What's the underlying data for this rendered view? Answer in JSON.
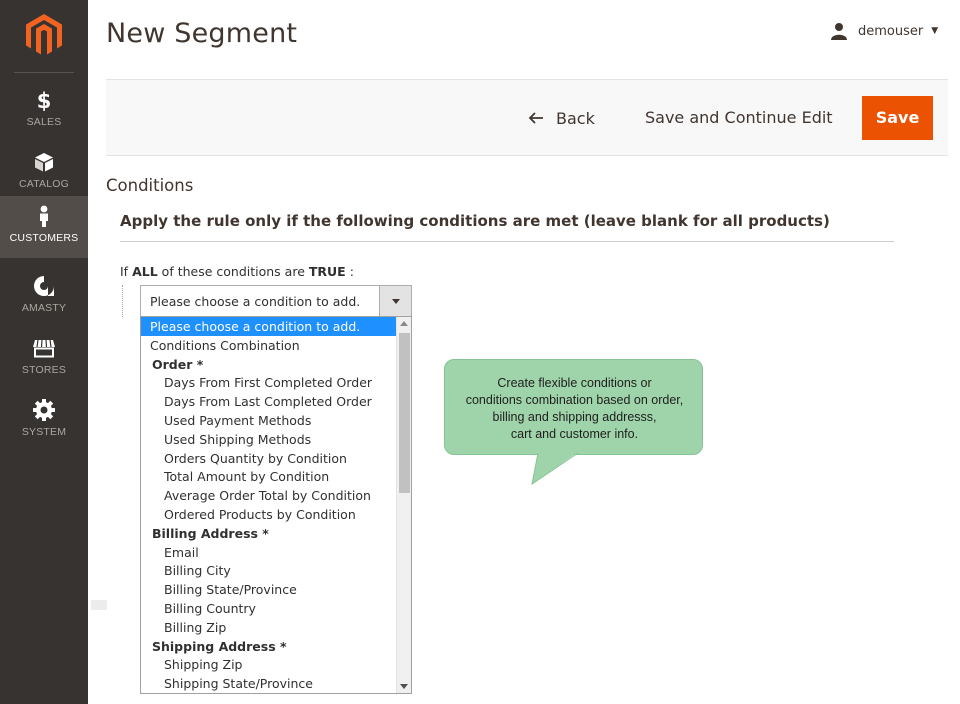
{
  "sidebar": {
    "items": [
      {
        "label": "SALES",
        "icon": "dollar-icon"
      },
      {
        "label": "CATALOG",
        "icon": "box-icon"
      },
      {
        "label": "CUSTOMERS",
        "icon": "person-icon",
        "active": true
      },
      {
        "label": "AMASTY",
        "icon": "amasty-icon"
      },
      {
        "label": "STORES",
        "icon": "store-icon"
      },
      {
        "label": "SYSTEM",
        "icon": "gear-icon"
      }
    ]
  },
  "header": {
    "title": "New Segment",
    "user": "demouser"
  },
  "actions": {
    "back": "Back",
    "save_continue": "Save and Continue Edit",
    "save": "Save"
  },
  "conditions": {
    "section_title": "Conditions",
    "heading": "Apply the rule only if the following conditions are met (leave blank for all products)",
    "if_prefix": "If",
    "aggregator": "ALL",
    "middle": "of these conditions are",
    "value": "TRUE",
    "suffix": ":",
    "select_value": "Please choose a condition to add.",
    "options": [
      {
        "label": "Please choose a condition to add.",
        "kind": "lvl0",
        "selected": true
      },
      {
        "label": "Conditions Combination",
        "kind": "lvl0"
      },
      {
        "label": "Order *",
        "kind": "grp"
      },
      {
        "label": "Days From First Completed Order",
        "kind": "lvl1"
      },
      {
        "label": "Days From Last Completed Order",
        "kind": "lvl1"
      },
      {
        "label": "Used Payment Methods",
        "kind": "lvl1"
      },
      {
        "label": "Used Shipping Methods",
        "kind": "lvl1"
      },
      {
        "label": "Orders Quantity by Condition",
        "kind": "lvl1"
      },
      {
        "label": "Total Amount by Condition",
        "kind": "lvl1"
      },
      {
        "label": "Average Order Total by Condition",
        "kind": "lvl1"
      },
      {
        "label": "Ordered Products by Condition",
        "kind": "lvl1"
      },
      {
        "label": "Billing Address *",
        "kind": "grp"
      },
      {
        "label": "Email",
        "kind": "lvl1"
      },
      {
        "label": "Billing City",
        "kind": "lvl1"
      },
      {
        "label": "Billing State/Province",
        "kind": "lvl1"
      },
      {
        "label": "Billing Country",
        "kind": "lvl1"
      },
      {
        "label": "Billing Zip",
        "kind": "lvl1"
      },
      {
        "label": "Shipping Address *",
        "kind": "grp"
      },
      {
        "label": "Shipping Zip",
        "kind": "lvl1"
      },
      {
        "label": "Shipping State/Province",
        "kind": "lvl1"
      }
    ]
  },
  "tooltip": {
    "lines": [
      "Create flexible conditions or",
      "conditions combination based on order,",
      "billing and shipping addresss,",
      "cart and customer info."
    ]
  },
  "colors": {
    "sidebar_bg": "#373330",
    "sidebar_active": "#524d49",
    "brand_orange": "#eb5202",
    "selected_option": "#1e90ff",
    "tooltip_bg": "#9fd3a9"
  }
}
